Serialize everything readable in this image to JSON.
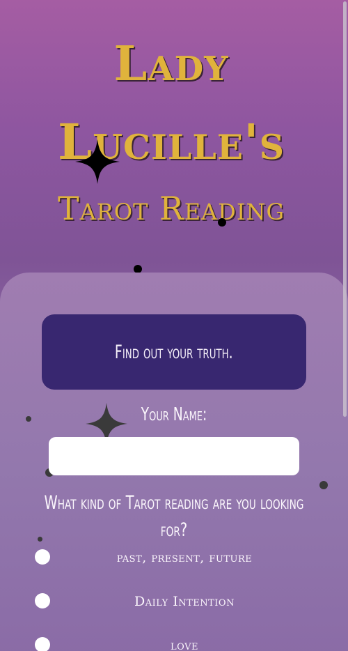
{
  "header": {
    "title_line1": "Lady",
    "title_line2": "Lucille's",
    "title_line3": "Tarot Reading"
  },
  "intro": {
    "tagline": "Find out your truth."
  },
  "form": {
    "name_label": "Your Name:",
    "name_value": "",
    "question": "What kind of Tarot reading are you looking for?",
    "options": [
      {
        "label": "past, present, future",
        "selected": false
      },
      {
        "label": "Daily Intention",
        "selected": false
      },
      {
        "label": "love",
        "selected": false
      }
    ]
  },
  "colors": {
    "title_gold": "#e0b33c",
    "panel_accent": "#382770",
    "background_top": "#a55da3",
    "background_panel": "#a07db1"
  },
  "decorations": {
    "sparkle_icon": "four-point-star-icon",
    "dot_icon": "dot-icon"
  }
}
